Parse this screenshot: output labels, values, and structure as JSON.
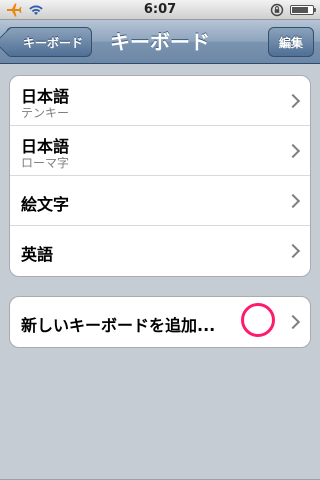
{
  "status": {
    "time": "6:07",
    "icons": [
      "airplane-icon",
      "wifi-icon",
      "rotation-lock-icon",
      "battery-icon"
    ],
    "battery_level": 0.8
  },
  "nav": {
    "back_label": "キーボード",
    "title": "キーボード",
    "edit_label": "編集"
  },
  "keyboards": [
    {
      "title": "日本語",
      "subtitle": "テンキー"
    },
    {
      "title": "日本語",
      "subtitle": "ローマ字"
    },
    {
      "title": "絵文字"
    },
    {
      "title": "英語"
    }
  ],
  "add_keyboard": {
    "label": "新しいキーボードを追加..."
  },
  "colors": {
    "highlight_circle": "#ff1a6d",
    "nav_accent": "#6d87a6"
  }
}
